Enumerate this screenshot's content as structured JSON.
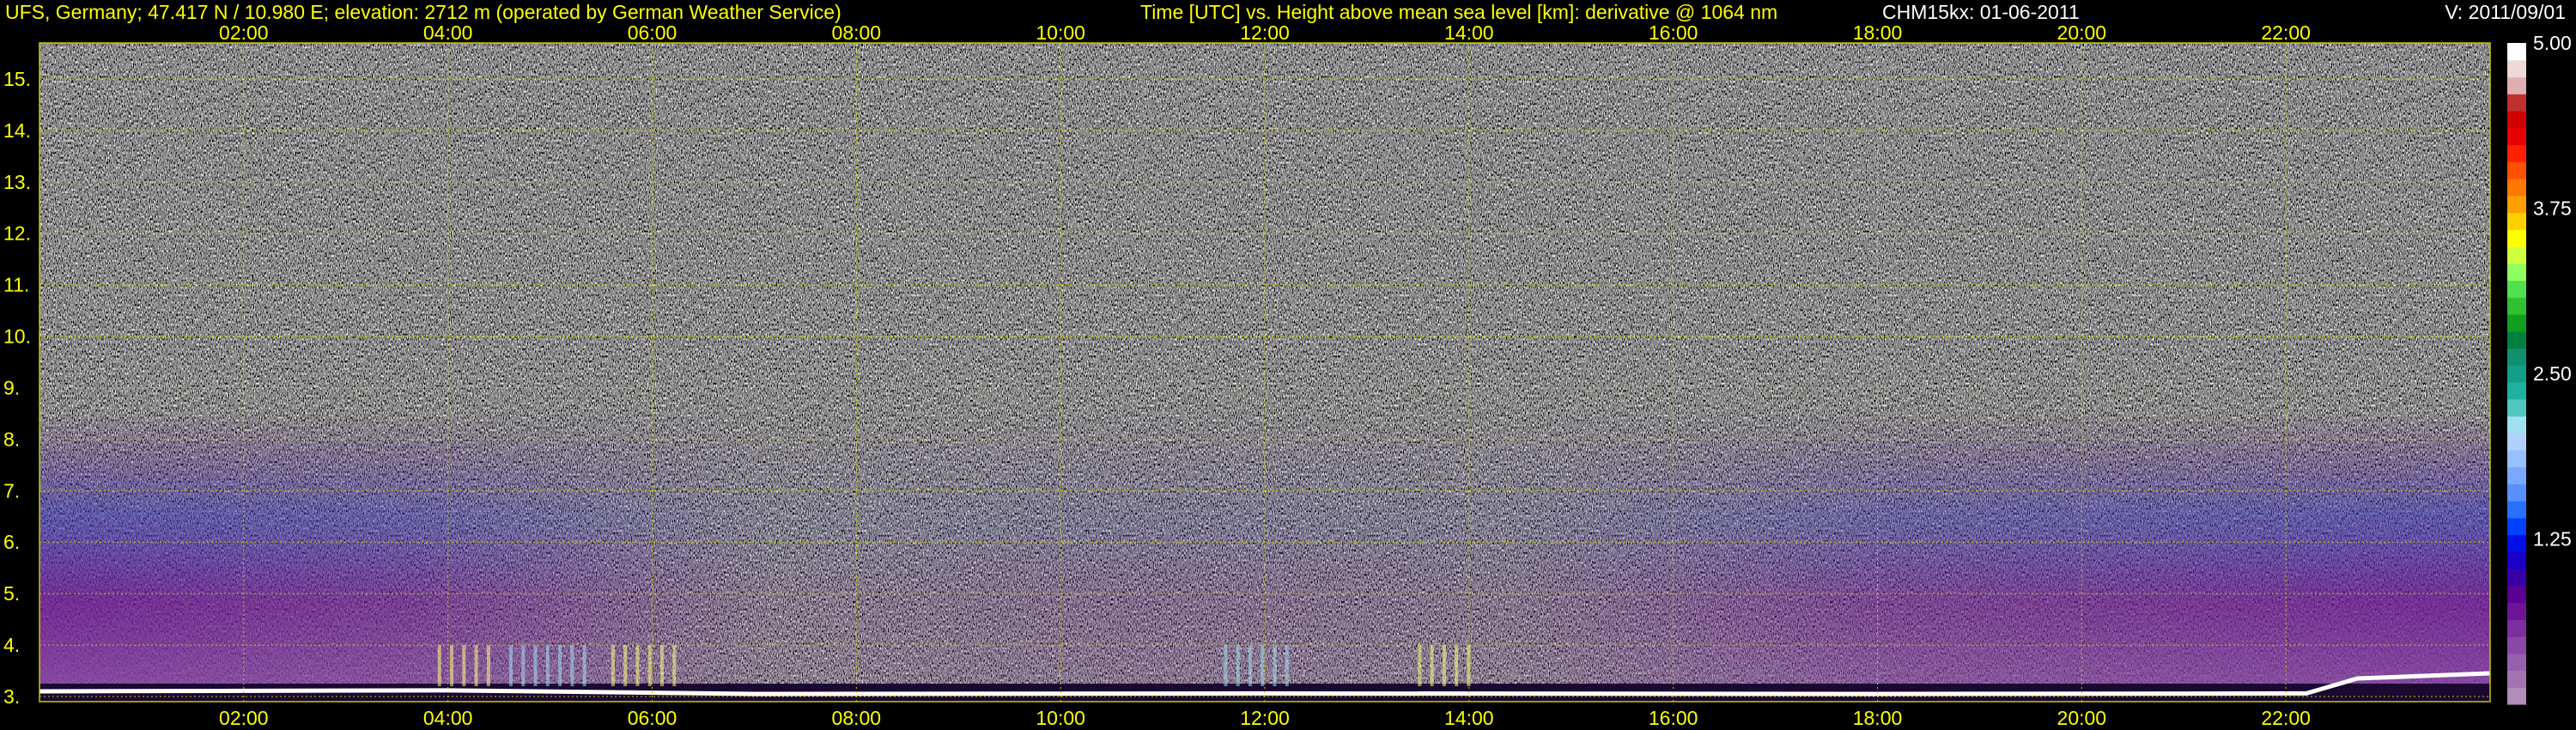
{
  "header": {
    "station": "UFS, Germany; 47.417 N / 10.980 E; elevation: 2712 m  (operated by German Weather Service)",
    "title": "Time [UTC] vs. Height above mean sea level [km]: derivative @ 1064 nm",
    "instrument": "CHM15kx: 01-06-2011",
    "version": "V: 2011/09/01"
  },
  "colors": {
    "text": "#ffff00",
    "grid": "#c8c800",
    "background": "#000000"
  },
  "chart_data": {
    "type": "heatmap",
    "title": "Time [UTC] vs. Height above mean sea level [km]: derivative @ 1064 nm",
    "xlabel": "Time [UTC]",
    "ylabel": "Height above mean sea level [km]",
    "x_range_hours": [
      0,
      24
    ],
    "y_range_km": [
      2.9,
      15.7
    ],
    "x_ticks": [
      "02:00",
      "04:00",
      "06:00",
      "08:00",
      "10:00",
      "12:00",
      "14:00",
      "16:00",
      "18:00",
      "20:00",
      "22:00"
    ],
    "y_ticks": [
      "3.",
      "4.",
      "5.",
      "6.",
      "7.",
      "8.",
      "9.",
      "10.",
      "11.",
      "12.",
      "13.",
      "14.",
      "15."
    ],
    "y_tick_values": [
      3,
      4,
      5,
      6,
      7,
      8,
      9,
      10,
      11,
      12,
      13,
      14,
      15
    ],
    "grid": true,
    "colorbar": {
      "range": [
        0,
        5
      ],
      "ticks": [
        "5.00",
        "3.75",
        "2.50",
        "1.25"
      ],
      "tick_values": [
        5.0,
        3.75,
        2.5,
        1.25
      ],
      "colors": [
        "#b28db9",
        "#a374b4",
        "#9560ad",
        "#8a48a6",
        "#7c2f9d",
        "#6d1596",
        "#5a0092",
        "#3a00a8",
        "#1a00c8",
        "#0010e6",
        "#0040ff",
        "#2a70ff",
        "#5890ff",
        "#7aa8ff",
        "#98bfff",
        "#b0d0ff",
        "#a0e0f0",
        "#50c8c0",
        "#20b0a0",
        "#10a088",
        "#109070",
        "#008040",
        "#10a020",
        "#30c030",
        "#50e050",
        "#90ff60",
        "#d0ff40",
        "#ffff00",
        "#ffd000",
        "#ffa000",
        "#ff7800",
        "#ff5000",
        "#ff2000",
        "#e80000",
        "#d00000",
        "#c03030",
        "#e0b0b0",
        "#f0d8d8",
        "#ffffff"
      ]
    }
  }
}
